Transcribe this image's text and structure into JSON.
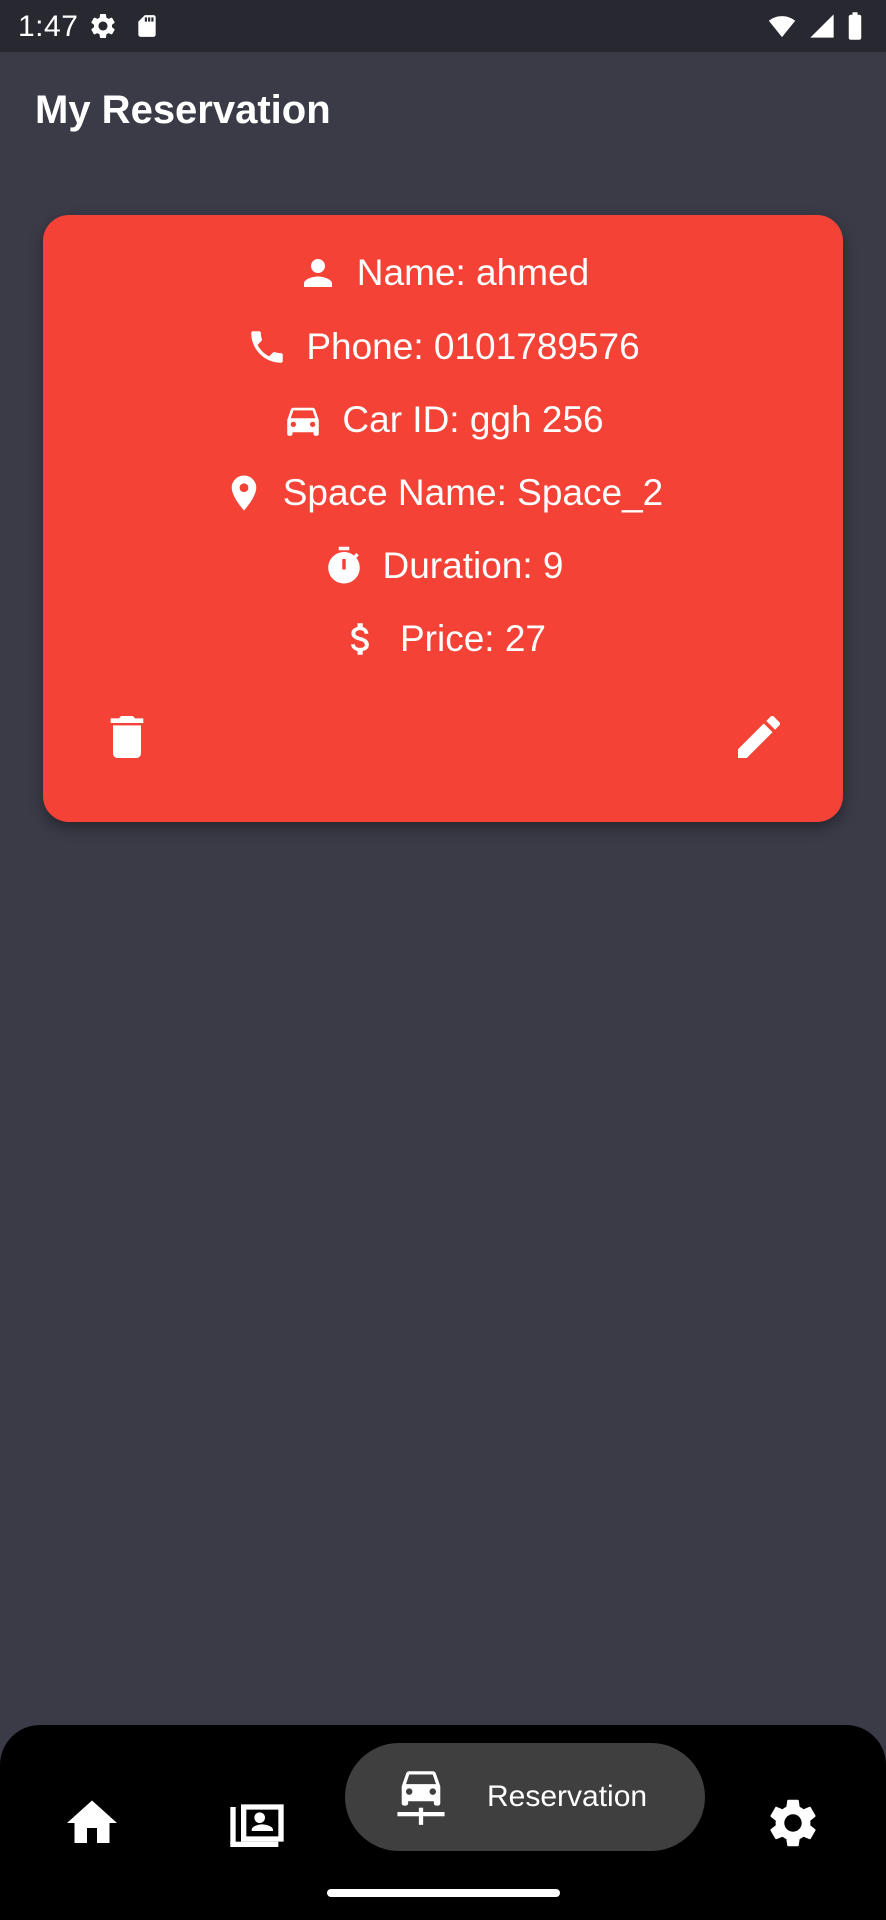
{
  "status_bar": {
    "time": "1:47",
    "icons": [
      "settings-gear-icon",
      "sd-card-icon",
      "wifi-icon",
      "cell-signal-icon",
      "battery-icon"
    ]
  },
  "app_bar": {
    "title": "My Reservation"
  },
  "reservation_card": {
    "color": "#f44336",
    "name": "Name: ahmed",
    "phone": "Phone: 0101789576",
    "car_id": "Car ID: ggh 256",
    "space_name": "Space Name: Space_2",
    "duration": "Duration: 9",
    "price": "Price: 27",
    "icons": [
      "person-icon",
      "phone-icon",
      "car-icon",
      "location-pin-icon",
      "timer-icon",
      "dollar-icon",
      "delete-icon",
      "edit-icon"
    ]
  },
  "bottom_nav": {
    "items": [
      {
        "icon": "home-icon"
      },
      {
        "icon": "gallery-icon"
      },
      {
        "icon": "car-parking-icon",
        "label": "Reservation",
        "active": true
      },
      {
        "icon": "settings-icon"
      }
    ],
    "active_label": "Reservation"
  },
  "colors": {
    "background": "#3a3b47",
    "status_bar": "#272830",
    "card": "#f44336",
    "nav_bar": "#000000",
    "nav_active": "#3f3f3f"
  }
}
